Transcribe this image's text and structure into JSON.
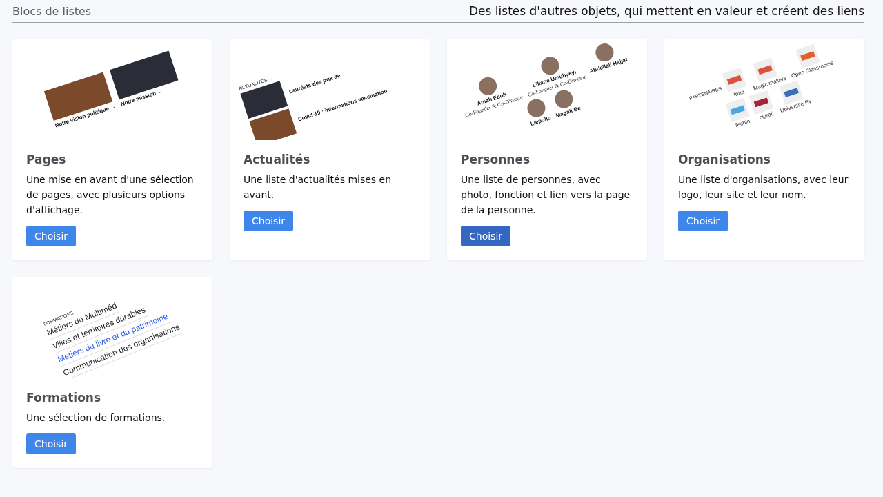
{
  "header": {
    "title": "Blocs de listes",
    "subtitle": "Des listes d'autres objets, qui mettent en valeur et créent des liens"
  },
  "cards": [
    {
      "title": "Pages",
      "description": "Une mise en avant d'une sélection de pages, avec plusieurs options d'affichage.",
      "button": {
        "label": "Choisir",
        "hovered": false
      },
      "preview": {
        "kind": "pages",
        "items": [
          {
            "title": "Notre vision politique →"
          },
          {
            "title": "Notre mission →"
          }
        ]
      }
    },
    {
      "title": "Actualités",
      "description": "Une liste d'actualités mises en avant.",
      "button": {
        "label": "Choisir",
        "hovered": false
      },
      "preview": {
        "kind": "news",
        "heading": "ACTUALITÉS →",
        "items": [
          {
            "title": "Lauréats des prix de"
          },
          {
            "title": "Covid-19 : informations vaccination"
          }
        ]
      }
    },
    {
      "title": "Personnes",
      "description": "Une liste de personnes, avec photo, fonction et lien vers la page de la personne.",
      "button": {
        "label": "Choisir",
        "hovered": true
      },
      "preview": {
        "kind": "people",
        "items": [
          {
            "title": "Amah Edoh",
            "subtitle": "Co-Founder & Co-Director"
          },
          {
            "title": "Liliane Umubyeyi",
            "subtitle": "Co-Founder & Co-Director"
          },
          {
            "title": "Abdellali Hajjat"
          },
          {
            "title": "Liepollo"
          },
          {
            "title": "Magali Be"
          }
        ]
      }
    },
    {
      "title": "Organisations",
      "description": "Une liste d'organisations, avec leur logo, leur site et leur nom.",
      "button": {
        "label": "Choisir",
        "hovered": false
      },
      "preview": {
        "kind": "logos",
        "heading": "PARTENAIRES",
        "items": [
          {
            "title": "Inria",
            "color": "#d9533f"
          },
          {
            "title": "Magic makers",
            "color": "#d9533f"
          },
          {
            "title": "Open Classrooms",
            "color": "#e0602a"
          },
          {
            "title": "Techin",
            "color": "#4aa8e0"
          },
          {
            "title": "cigref",
            "color": "#a4243b"
          },
          {
            "title": "Université Ev",
            "color": "#3a6fb5"
          }
        ]
      }
    },
    {
      "title": "Formations",
      "description": "Une sélection de formations.",
      "button": {
        "label": "Choisir",
        "hovered": false
      },
      "preview": {
        "kind": "list",
        "heading": "FORMATIONS",
        "items": [
          {
            "title": "Métiers du Multiméd",
            "selected": false
          },
          {
            "title": "Villes et territoires durables",
            "selected": false
          },
          {
            "title": "Métiers du livre et du patrimoine",
            "selected": true
          },
          {
            "title": "Communication des organisations",
            "selected": false
          }
        ]
      }
    }
  ]
}
